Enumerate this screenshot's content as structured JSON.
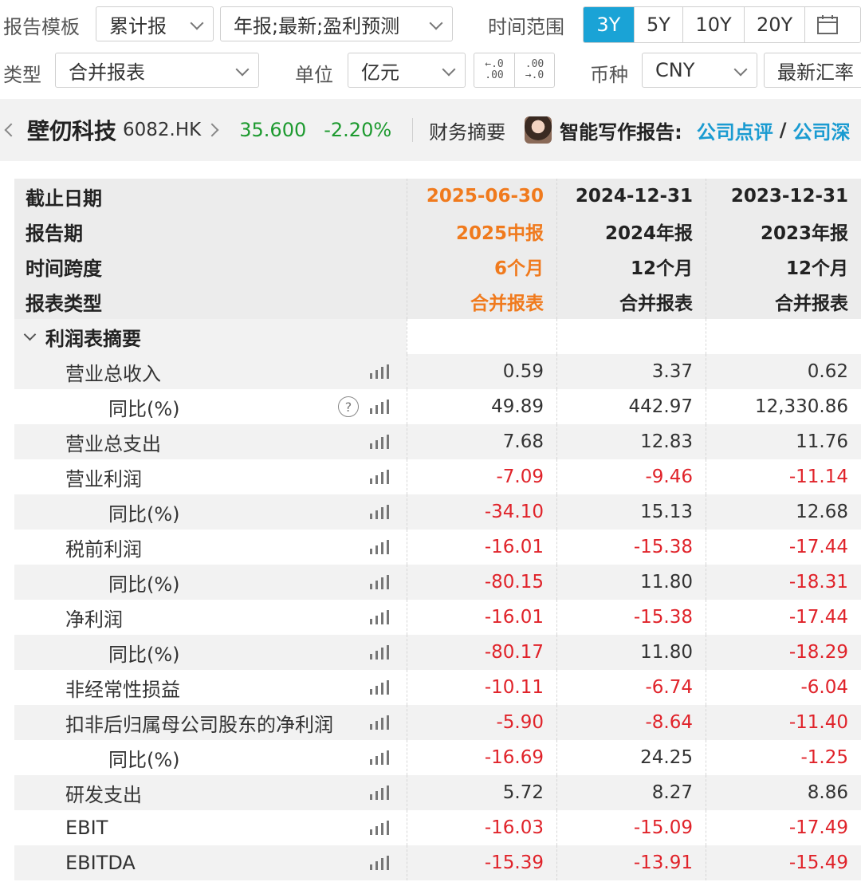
{
  "filters": {
    "template_label": "报告模板",
    "template_value": "累计报",
    "report_selection": "年报;最新;盈利预测",
    "time_range_label": "时间范围",
    "time_ranges": [
      "3Y",
      "5Y",
      "10Y",
      "20Y"
    ],
    "time_range_active": "3Y",
    "type_label": "类型",
    "type_value": "合并报表",
    "unit_label": "单位",
    "unit_value": "亿元",
    "decimal_increase": "←.0\n.00",
    "decimal_decrease": ".00\n→.0",
    "currency_label": "币种",
    "currency_value": "CNY",
    "fx_value": "最新汇率"
  },
  "stock": {
    "name": "壁仞科技",
    "code": "6082.HK",
    "price": "35.600",
    "change": "-2.20%",
    "summary_tab": "财务摘要",
    "ai_label": "智能写作报告:",
    "ai_link1": "公司点评",
    "ai_sep": "/",
    "ai_link2": "公司深"
  },
  "colors": {
    "accent": "#1aa3d6",
    "current_period": "#f07a1d",
    "negative": "#e0232a",
    "price_down": "#1d9a2f"
  },
  "table": {
    "header_rows": [
      {
        "label": "截止日期",
        "values": [
          "2025-06-30",
          "2024-12-31",
          "2023-12-31"
        ]
      },
      {
        "label": "报告期",
        "values": [
          "2025中报",
          "2024年报",
          "2023年报"
        ]
      },
      {
        "label": "时间跨度",
        "values": [
          "6个月",
          "12个月",
          "12个月"
        ]
      },
      {
        "label": "报表类型",
        "values": [
          "合并报表",
          "合并报表",
          "合并报表"
        ]
      }
    ],
    "section_title": "利润表摘要",
    "rows": [
      {
        "label": "营业总收入",
        "level": 1,
        "help": false,
        "values": [
          "0.59",
          "3.37",
          "0.62"
        ]
      },
      {
        "label": "同比(%)",
        "level": 2,
        "help": true,
        "values": [
          "49.89",
          "442.97",
          "12,330.86"
        ]
      },
      {
        "label": "营业总支出",
        "level": 1,
        "help": false,
        "values": [
          "7.68",
          "12.83",
          "11.76"
        ]
      },
      {
        "label": "营业利润",
        "level": 1,
        "help": false,
        "values": [
          "-7.09",
          "-9.46",
          "-11.14"
        ]
      },
      {
        "label": "同比(%)",
        "level": 2,
        "help": false,
        "values": [
          "-34.10",
          "15.13",
          "12.68"
        ]
      },
      {
        "label": "税前利润",
        "level": 1,
        "help": false,
        "values": [
          "-16.01",
          "-15.38",
          "-17.44"
        ]
      },
      {
        "label": "同比(%)",
        "level": 2,
        "help": false,
        "values": [
          "-80.15",
          "11.80",
          "-18.31"
        ]
      },
      {
        "label": "净利润",
        "level": 1,
        "help": false,
        "values": [
          "-16.01",
          "-15.38",
          "-17.44"
        ]
      },
      {
        "label": "同比(%)",
        "level": 2,
        "help": false,
        "values": [
          "-80.17",
          "11.80",
          "-18.29"
        ]
      },
      {
        "label": "非经常性损益",
        "level": 1,
        "help": false,
        "values": [
          "-10.11",
          "-6.74",
          "-6.04"
        ]
      },
      {
        "label": "扣非后归属母公司股东的净利润",
        "level": 1,
        "help": false,
        "values": [
          "-5.90",
          "-8.64",
          "-11.40"
        ]
      },
      {
        "label": "同比(%)",
        "level": 2,
        "help": false,
        "values": [
          "-16.69",
          "24.25",
          "-1.25"
        ]
      },
      {
        "label": "研发支出",
        "level": 1,
        "help": false,
        "values": [
          "5.72",
          "8.27",
          "8.86"
        ]
      },
      {
        "label": "EBIT",
        "level": 1,
        "help": false,
        "values": [
          "-16.03",
          "-15.09",
          "-17.49"
        ]
      },
      {
        "label": "EBITDA",
        "level": 1,
        "help": false,
        "values": [
          "-15.39",
          "-13.91",
          "-15.49"
        ]
      }
    ]
  }
}
